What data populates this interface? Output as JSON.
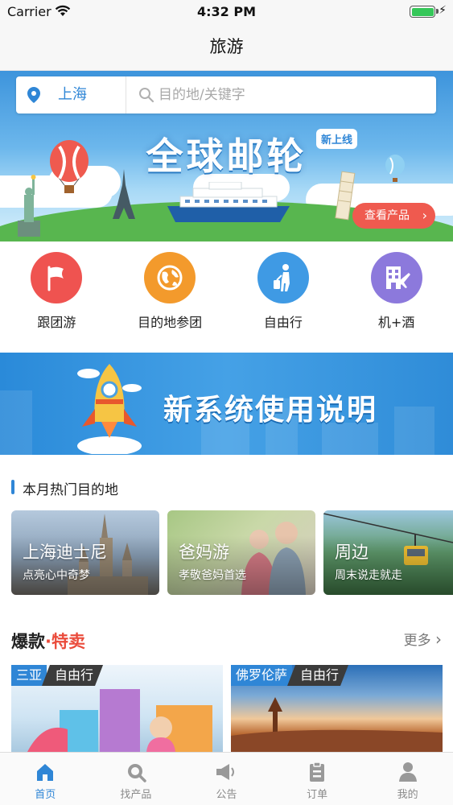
{
  "status_bar": {
    "carrier": "Carrier",
    "time": "4:32 PM"
  },
  "navbar": {
    "title": "旅游"
  },
  "search": {
    "city": "上海",
    "placeholder": "目的地/关键字"
  },
  "hero_banner": {
    "headline": "全球邮轮",
    "badge": "新上线",
    "cta": "查看产品"
  },
  "categories": [
    {
      "label": "跟团游",
      "color": "#ef5350",
      "icon": "flag-icon"
    },
    {
      "label": "目的地参团",
      "color": "#f39a2c",
      "icon": "globe-icon"
    },
    {
      "label": "自由行",
      "color": "#3f9ae4",
      "icon": "traveler-icon"
    },
    {
      "label": "机+酒",
      "color": "#8c79dc",
      "icon": "hotel-plane-icon"
    }
  ],
  "promo_banner": {
    "text": "新系统使用说明"
  },
  "hot_destinations": {
    "title": "本月热门目的地",
    "items": [
      {
        "title": "上海迪士尼",
        "subtitle": "点亮心中奇梦"
      },
      {
        "title": "爸妈游",
        "subtitle": "孝敬爸妈首选"
      },
      {
        "title": "周边",
        "subtitle": "周末说走就走"
      }
    ]
  },
  "deals": {
    "title_a": "爆款",
    "dot": "·",
    "title_b": "特卖",
    "more": "更多",
    "items": [
      {
        "place": "三亚",
        "type": "自由行"
      },
      {
        "place": "佛罗伦萨",
        "type": "自由行"
      }
    ]
  },
  "tabbar": [
    {
      "label": "首页",
      "icon": "home-icon",
      "active": true
    },
    {
      "label": "找产品",
      "icon": "search-icon",
      "active": false
    },
    {
      "label": "公告",
      "icon": "megaphone-icon",
      "active": false
    },
    {
      "label": "订单",
      "icon": "clipboard-icon",
      "active": false
    },
    {
      "label": "我的",
      "icon": "person-icon",
      "active": false
    }
  ],
  "colors": {
    "accent": "#2f86d6",
    "deal_red": "#ea4b3b",
    "cta_red": "#ef5a4f"
  }
}
